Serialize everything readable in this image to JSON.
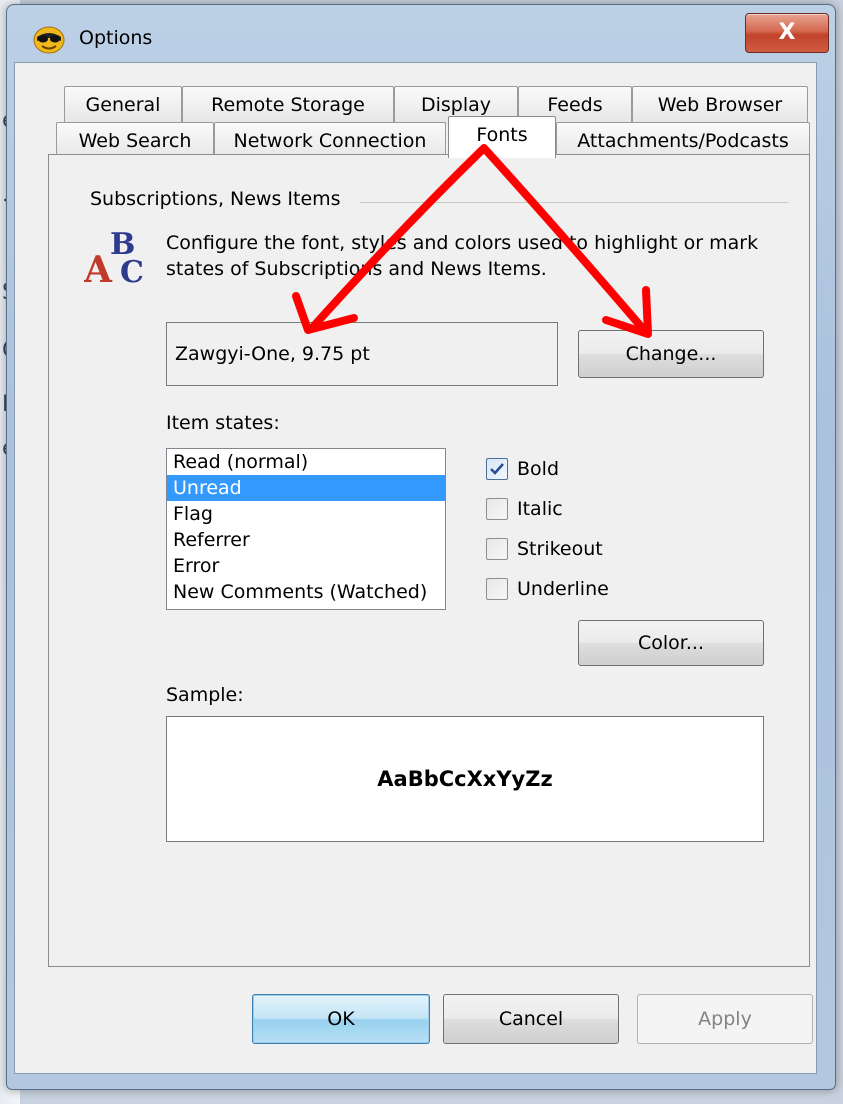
{
  "window": {
    "title": "Options",
    "close_label": "X"
  },
  "tabs": {
    "row1": [
      "General",
      "Remote Storage",
      "Display",
      "Feeds",
      "Web Browser"
    ],
    "row2": [
      "Web Search",
      "Network Connection",
      "Fonts",
      "Attachments/Podcasts"
    ],
    "selected": "Fonts"
  },
  "group": {
    "title": "Subscriptions, News Items",
    "description": "Configure the font, styles and colors used to highlight or mark states of Subscriptions and News Items."
  },
  "font": {
    "current": "Zawgyi-One, 9.75 pt",
    "change_label": "Change..."
  },
  "item_states": {
    "label": "Item states:",
    "items": [
      "Read (normal)",
      "Unread",
      "Flag",
      "Referrer",
      "Error",
      "New Comments (Watched)"
    ],
    "selected": "Unread"
  },
  "styles": [
    {
      "label": "Bold",
      "checked": true
    },
    {
      "label": "Italic",
      "checked": false
    },
    {
      "label": "Strikeout",
      "checked": false
    },
    {
      "label": "Underline",
      "checked": false
    }
  ],
  "color_label": "Color...",
  "sample": {
    "label": "Sample:",
    "text": "AaBbCcXxYyZz"
  },
  "buttons": {
    "ok": "OK",
    "cancel": "Cancel",
    "apply": "Apply"
  },
  "colors": {
    "selection": "#3399ff",
    "annotation_arrows": "#ff0000",
    "close_button": "#c0432a"
  }
}
